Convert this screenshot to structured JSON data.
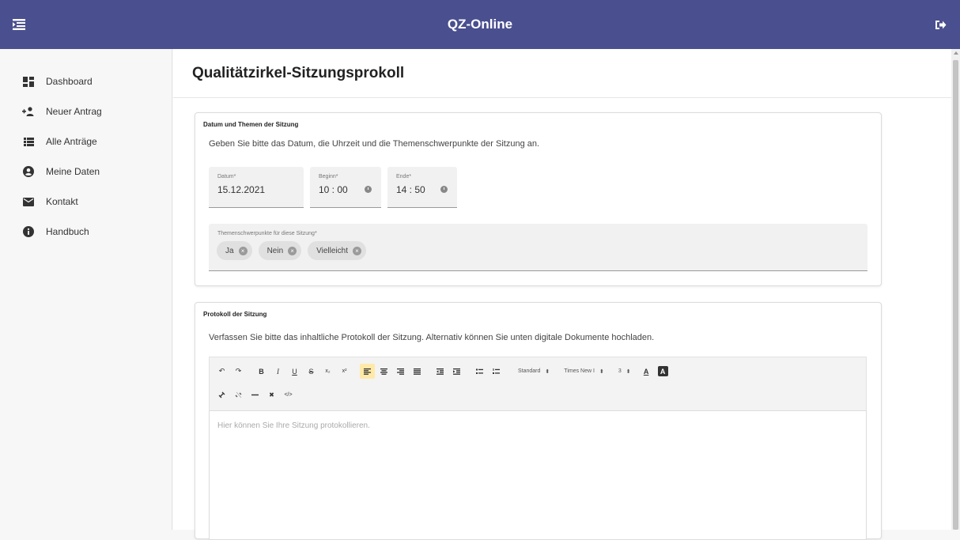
{
  "app": {
    "title": "QZ-Online"
  },
  "sidebar": {
    "items": [
      {
        "label": "Dashboard",
        "icon": "dashboard-icon"
      },
      {
        "label": "Neuer Antrag",
        "icon": "add-user-icon"
      },
      {
        "label": "Alle Anträge",
        "icon": "list-icon"
      },
      {
        "label": "Meine Daten",
        "icon": "account-circle-icon"
      },
      {
        "label": "Kontakt",
        "icon": "mail-icon"
      },
      {
        "label": "Handbuch",
        "icon": "info-icon"
      }
    ]
  },
  "page": {
    "title": "Qualitätzirkel-Sitzungsprokoll"
  },
  "session": {
    "card_title": "Datum und Themen der Sitzung",
    "description": "Geben Sie bitte das Datum, die Uhrzeit und die Themenschwerpunkte der Sitzung an.",
    "date": {
      "label": "Datum*",
      "value": "15.12.2021"
    },
    "begin": {
      "label": "Beginn*",
      "value": "10 : 00"
    },
    "end": {
      "label": "Ende*",
      "value": "14 : 50"
    },
    "topics": {
      "label": "Themenschwerpunkte für diese Sitzung*",
      "chips": [
        "Ja",
        "Nein",
        "Vielleicht"
      ]
    }
  },
  "protocol": {
    "card_title": "Protokoll der Sitzung",
    "description": "Verfassen Sie bitte das inhaltliche Protokoll der Sitzung. Alternativ können Sie unten digitale Dokumente hochladen.",
    "toolbar": {
      "undo": "↶",
      "redo": "↷",
      "bold": "B",
      "italic": "I",
      "underline": "U",
      "strike": "S",
      "subscript": "x₂",
      "superscript": "x²",
      "format_select": "Standard",
      "font_select": "Times New I",
      "size_select": "3",
      "text_color": "A",
      "bg_color": "A",
      "clear": "✖",
      "code": "</>"
    },
    "editor_placeholder": "Hier können Sie Ihre Sitzung protokollieren."
  },
  "colors": {
    "header": "#4a4f8f",
    "active_tool": "#ffe9a8"
  }
}
